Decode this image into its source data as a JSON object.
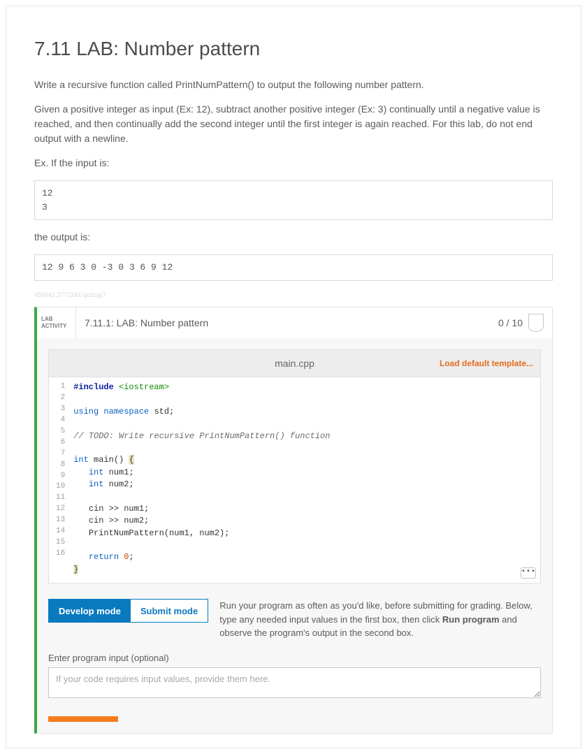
{
  "title": "7.11 LAB: Number pattern",
  "paragraphs": {
    "p1": "Write a recursive function called PrintNumPattern() to output the following number pattern.",
    "p2": "Given a positive integer as input (Ex: 12), subtract another positive integer (Ex: 3) continually until a negative value is reached, and then continually add the second integer until the first integer is again reached. For this lab, do not end output with a newline.",
    "p3": "Ex. If the input is:",
    "p4": "the output is:"
  },
  "io": {
    "input": "12\n3",
    "output": "12 9 6 3 0 -3 0 3 6 9 12"
  },
  "watermark": "450942.2771164.qx3zqy7",
  "lab": {
    "tag_line1": "LAB",
    "tag_line2": "ACTIVITY",
    "number_title": "7.11.1: LAB: Number pattern",
    "score": "0 / 10"
  },
  "file": {
    "name": "main.cpp",
    "load_template": "Load default template..."
  },
  "code": {
    "line_count": 16,
    "source_plain": "#include <iostream>\n\nusing namespace std;\n\n// TODO: Write recursive PrintNumPattern() function\n\nint main() {\n   int num1;\n   int num2;\n\n   cin >> num1;\n   cin >> num2;\n   PrintNumPattern(num1, num2);\n\n   return 0;\n}",
    "tokens": {
      "l1_inc": "#include",
      "l1_hdr": "<iostream>",
      "l3_using": "using",
      "l3_ns": "namespace",
      "l3_std": "std",
      "l5_com": "// TODO: Write recursive PrintNumPattern() function",
      "l7_int": "int",
      "l7_main": "main",
      "l8_int": "int",
      "l8_v": "num1",
      "l9_int": "int",
      "l9_v": "num2",
      "l11_cin": "cin",
      "l11_v": "num1",
      "l12_cin": "cin",
      "l12_v": "num2",
      "l13_fn": "PrintNumPattern",
      "l13_args": "(num1, num2)",
      "l15_ret": "return",
      "l15_zero": "0"
    }
  },
  "modes": {
    "develop": "Develop mode",
    "submit": "Submit mode",
    "desc_pre": "Run your program as often as you'd like, before submitting for grading. Below, type any needed input values in the first box, then click ",
    "desc_bold": "Run program",
    "desc_post": " and observe the program's output in the second box."
  },
  "input_section": {
    "label": "Enter program input (optional)",
    "placeholder": "If your code requires input values, provide them here."
  }
}
